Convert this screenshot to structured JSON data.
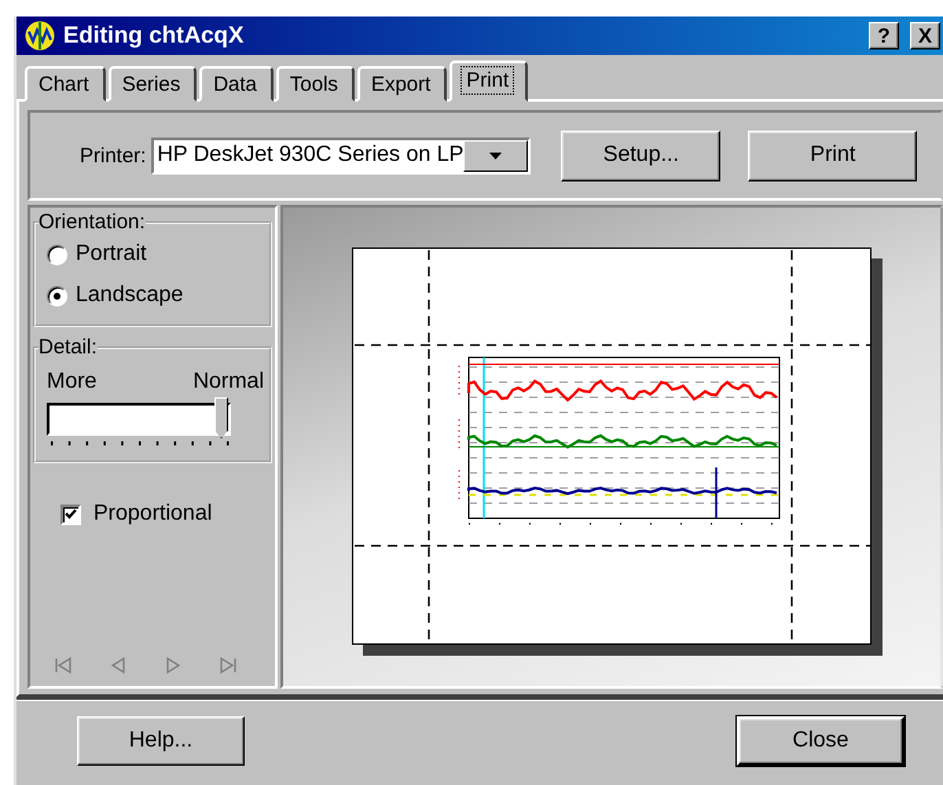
{
  "window": {
    "title": "Editing chtAcqX",
    "help_button": "?",
    "close_button": "X"
  },
  "tabs": [
    {
      "label": "Chart",
      "selected": false
    },
    {
      "label": "Series",
      "selected": false
    },
    {
      "label": "Data",
      "selected": false
    },
    {
      "label": "Tools",
      "selected": false
    },
    {
      "label": "Export",
      "selected": false
    },
    {
      "label": "Print",
      "selected": true
    }
  ],
  "printer": {
    "label": "Printer:",
    "value": "HP DeskJet 930C Series on LP"
  },
  "top_buttons": [
    {
      "label": "Setup..."
    },
    {
      "label": "Print"
    }
  ],
  "orientation": {
    "label": "Orientation:",
    "options": [
      {
        "label": "Portrait",
        "selected": false
      },
      {
        "label": "Landscape",
        "selected": true
      }
    ]
  },
  "detail": {
    "label": "Detail:",
    "min_label": "More",
    "max_label": "Normal",
    "level": 1
  },
  "proportional": {
    "label": "Proportional",
    "checked": true
  },
  "navigation": [
    {
      "kind": "first",
      "disabled": true
    },
    {
      "kind": "prev",
      "disabled": true
    },
    {
      "kind": "next",
      "disabled": true
    },
    {
      "kind": "last",
      "disabled": true
    }
  ],
  "footer_buttons": [
    {
      "label": "Help...",
      "default": false
    },
    {
      "label": "Close",
      "default": true
    }
  ]
}
